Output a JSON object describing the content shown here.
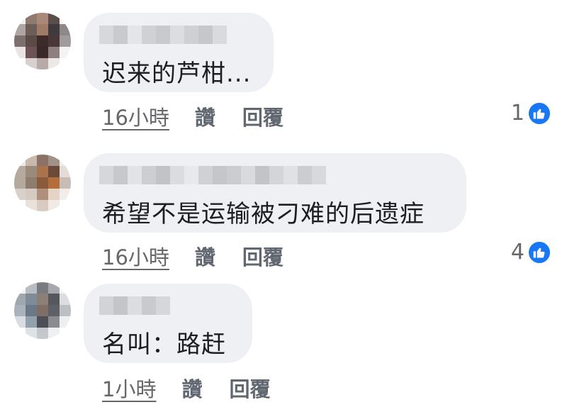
{
  "comments": [
    {
      "text": "迟来的芦柑...",
      "time": "16小時",
      "like_label": "讚",
      "reply_label": "回覆",
      "reactions": "1"
    },
    {
      "text": "希望不是运输被刁难的后遗症",
      "time": "16小時",
      "like_label": "讚",
      "reply_label": "回覆",
      "reactions": "4"
    },
    {
      "text": "名叫：路赶",
      "time": "1小時",
      "like_label": "讚",
      "reply_label": "回覆"
    }
  ],
  "icons": {
    "reaction": "thumbs-up-icon"
  },
  "colors": {
    "bubble": "#eef0f3",
    "like_badge": "#1877f2",
    "text": "#1c1e21",
    "meta": "#65676b"
  }
}
